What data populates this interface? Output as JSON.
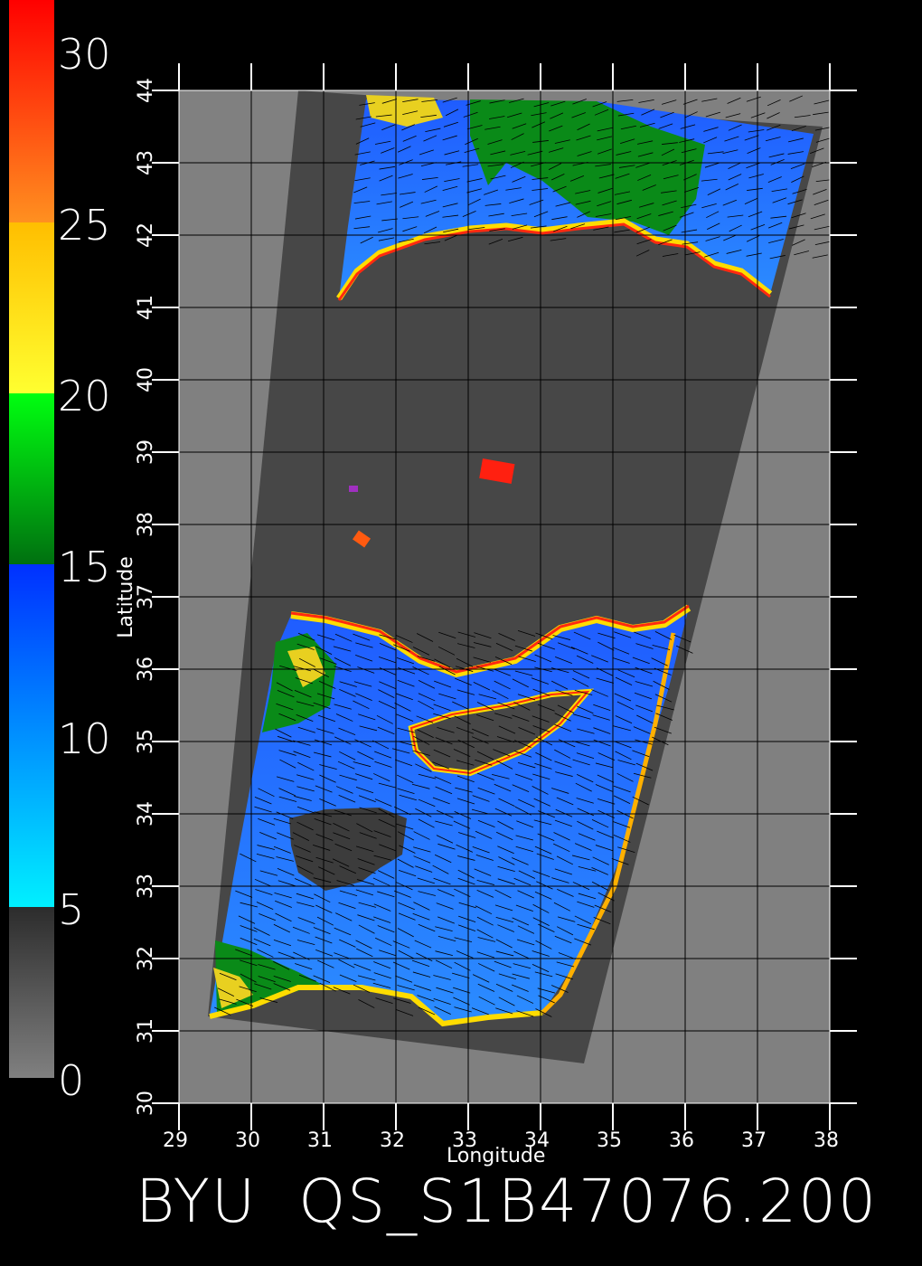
{
  "colorbar": {
    "labels": [
      "30",
      "25",
      "20",
      "15",
      "10",
      "5",
      "0"
    ],
    "label_values": [
      30,
      25,
      20,
      15,
      10,
      5,
      0
    ],
    "range": [
      0,
      31.5
    ],
    "bands": [
      {
        "from": 0,
        "to": 5,
        "colors": [
          "#808080",
          "#2c2c2c"
        ]
      },
      {
        "from": 5,
        "to": 15,
        "colors": [
          "#00f0ff",
          "#0030ff"
        ]
      },
      {
        "from": 15,
        "to": 20,
        "colors": [
          "#007010",
          "#00ff10"
        ]
      },
      {
        "from": 20,
        "to": 25,
        "colors": [
          "#ffff30",
          "#ffbe00"
        ]
      },
      {
        "from": 25,
        "to": 31.5,
        "colors": [
          "#ff9020",
          "#ff0000"
        ]
      }
    ]
  },
  "axes": {
    "x_label": "Longitude",
    "y_label": "Latitude",
    "x_ticks": [
      "29",
      "30",
      "31",
      "32",
      "33",
      "34",
      "35",
      "36",
      "37",
      "38"
    ],
    "y_ticks": [
      "30",
      "31",
      "32",
      "33",
      "34",
      "35",
      "36",
      "37",
      "38",
      "39",
      "40",
      "41",
      "42",
      "43",
      "44"
    ],
    "x_range": [
      29,
      38
    ],
    "y_range": [
      30,
      44
    ]
  },
  "swath": {
    "corners": [
      [
        30.65,
        44.0
      ],
      [
        37.9,
        43.5
      ],
      [
        34.6,
        30.55
      ],
      [
        29.4,
        31.2
      ]
    ]
  },
  "colors": {
    "background": "#000000",
    "plot_background": "#808080",
    "land": "#474747",
    "gridline": "#000000",
    "vectors": "#000000"
  },
  "title": "BYU  QS_S1B47076.200"
}
